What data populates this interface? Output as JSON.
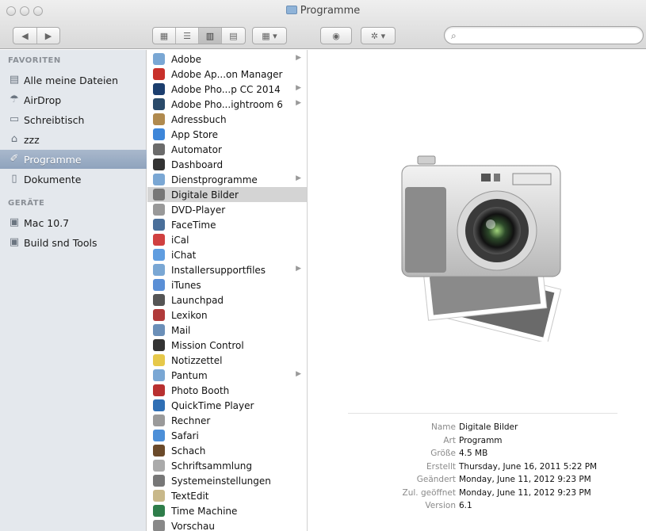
{
  "window": {
    "title": "Programme"
  },
  "toolbar": {
    "back_icon": "back-arrow",
    "forward_icon": "forward-arrow",
    "view_modes": [
      "icon-view",
      "list-view",
      "column-view",
      "coverflow-view"
    ],
    "arrange_icon": "arrange-menu",
    "quicklook_icon": "eye",
    "action_icon": "gear",
    "search_placeholder": ""
  },
  "sidebar": {
    "favorites_header": "FAVORITEN",
    "favorites": [
      {
        "label": "Alle meine Dateien",
        "icon": "all-files"
      },
      {
        "label": "AirDrop",
        "icon": "airdrop"
      },
      {
        "label": "Schreibtisch",
        "icon": "desktop"
      },
      {
        "label": "zzz",
        "icon": "home"
      },
      {
        "label": "Programme",
        "icon": "applications",
        "selected": true
      },
      {
        "label": "Dokumente",
        "icon": "documents"
      }
    ],
    "devices_header": "GERÄTE",
    "devices": [
      {
        "label": "Mac 10.7",
        "icon": "disk"
      },
      {
        "label": "Build snd Tools",
        "icon": "disk"
      }
    ]
  },
  "list": {
    "items": [
      {
        "label": "Adobe",
        "folder": true,
        "color": "#7aa7d4"
      },
      {
        "label": "Adobe Ap...on Manager",
        "folder": false,
        "color": "#c8302a"
      },
      {
        "label": "Adobe Pho...p CC 2014",
        "folder": true,
        "color": "#1c3e6e"
      },
      {
        "label": "Adobe Pho...ightroom 6",
        "folder": true,
        "color": "#2a4a6a"
      },
      {
        "label": "Adressbuch",
        "folder": false,
        "color": "#b08a4e"
      },
      {
        "label": "App Store",
        "folder": false,
        "color": "#3d86d9"
      },
      {
        "label": "Automator",
        "folder": false,
        "color": "#6b6b6b"
      },
      {
        "label": "Dashboard",
        "folder": false,
        "color": "#333333"
      },
      {
        "label": "Dienstprogramme",
        "folder": true,
        "color": "#7aa7d4"
      },
      {
        "label": "Digitale Bilder",
        "folder": false,
        "color": "#777777",
        "selected": true
      },
      {
        "label": "DVD-Player",
        "folder": false,
        "color": "#999999"
      },
      {
        "label": "FaceTime",
        "folder": false,
        "color": "#4a6f9a"
      },
      {
        "label": "iCal",
        "folder": false,
        "color": "#d04040"
      },
      {
        "label": "iChat",
        "folder": false,
        "color": "#5f9de0"
      },
      {
        "label": "Installersupportfiles",
        "folder": true,
        "color": "#7aa7d4"
      },
      {
        "label": "iTunes",
        "folder": false,
        "color": "#5a8fd6"
      },
      {
        "label": "Launchpad",
        "folder": false,
        "color": "#555555"
      },
      {
        "label": "Lexikon",
        "folder": false,
        "color": "#b03a3a"
      },
      {
        "label": "Mail",
        "folder": false,
        "color": "#6b8fb8"
      },
      {
        "label": "Mission Control",
        "folder": false,
        "color": "#333333"
      },
      {
        "label": "Notizzettel",
        "folder": false,
        "color": "#e6c84a"
      },
      {
        "label": "Pantum",
        "folder": true,
        "color": "#7aa7d4"
      },
      {
        "label": "Photo Booth",
        "folder": false,
        "color": "#b83030"
      },
      {
        "label": "QuickTime Player",
        "folder": false,
        "color": "#2f6fb5"
      },
      {
        "label": "Rechner",
        "folder": false,
        "color": "#9a9a9a"
      },
      {
        "label": "Safari",
        "folder": false,
        "color": "#4c8fd8"
      },
      {
        "label": "Schach",
        "folder": false,
        "color": "#6b4a2a"
      },
      {
        "label": "Schriftsammlung",
        "folder": false,
        "color": "#aaaaaa"
      },
      {
        "label": "Systemeinstellungen",
        "folder": false,
        "color": "#777777"
      },
      {
        "label": "TextEdit",
        "folder": false,
        "color": "#c8b88a"
      },
      {
        "label": "Time Machine",
        "folder": false,
        "color": "#2e7d4a"
      },
      {
        "label": "Vorschau",
        "folder": false,
        "color": "#888888"
      }
    ]
  },
  "preview": {
    "image_icon": "camera-with-photos",
    "info": [
      {
        "key": "Name",
        "value": "Digitale Bilder"
      },
      {
        "key": "Art",
        "value": "Programm"
      },
      {
        "key": "Größe",
        "value": "4.5 MB"
      },
      {
        "key": "Erstellt",
        "value": "Thursday, June 16, 2011 5:22 PM"
      },
      {
        "key": "Geändert",
        "value": "Monday, June 11, 2012 9:23 PM"
      },
      {
        "key": "Zul. geöffnet",
        "value": "Monday, June 11, 2012 9:23 PM"
      },
      {
        "key": "Version",
        "value": "6.1"
      }
    ]
  }
}
